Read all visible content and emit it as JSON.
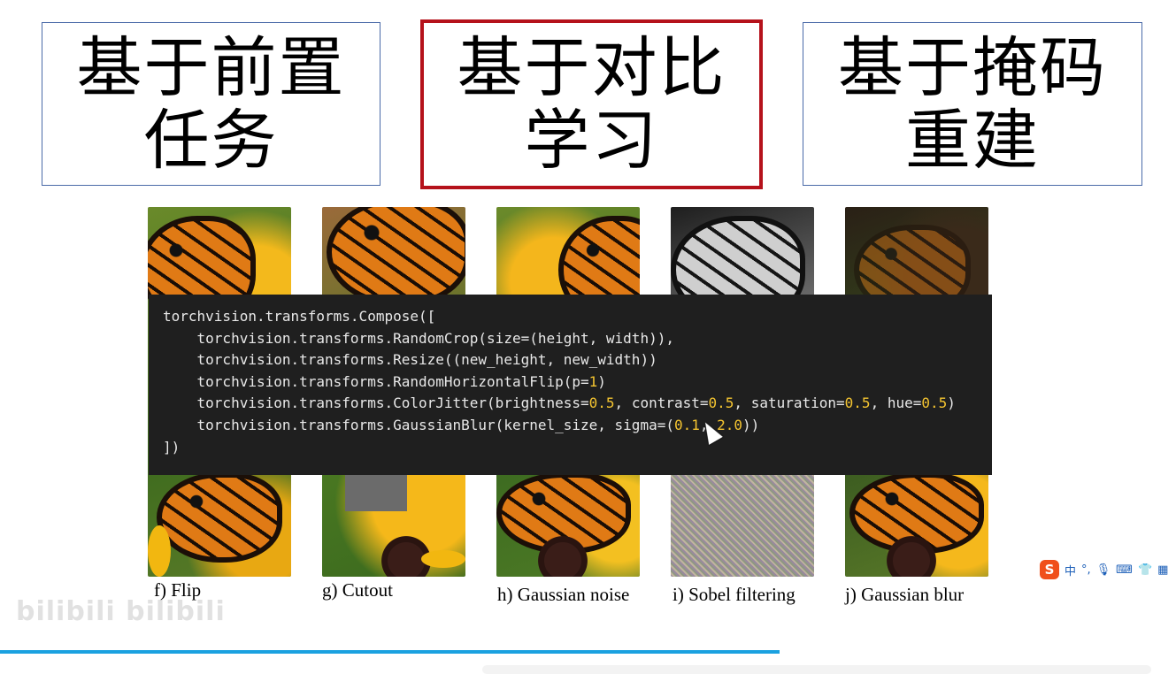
{
  "header": {
    "boxes": [
      {
        "title": "基于前置\n任务"
      },
      {
        "title": "基于对比\n学习"
      },
      {
        "title": "基于掩码\n重建"
      }
    ]
  },
  "images": {
    "captions": [
      "f) Flip",
      "g) Cutout",
      "h) Gaussian noise",
      "i) Sobel filtering",
      "j) Gaussian blur"
    ]
  },
  "code": {
    "lines": [
      "torchvision.transforms.Compose([",
      "    torchvision.transforms.RandomCrop(size=(height, width)),",
      "    torchvision.transforms.Resize((new_height, new_width))",
      "    torchvision.transforms.RandomHorizontalFlip(p=1)",
      "    torchvision.transforms.ColorJitter(brightness=0.5, contrast=0.5, saturation=0.5, hue=0.5)",
      "    torchvision.transforms.GaussianBlur(kernel_size, sigma=(0.1, 2.0))",
      "])"
    ],
    "colors": {
      "background": "#1f1f1f",
      "text": "#e8e8e8",
      "number": "#f4c430"
    }
  },
  "watermark": {
    "text": "bilibili bilibili"
  },
  "ime_toolbar": {
    "logo": "S",
    "label": "中",
    "icons": [
      "punctuation-icon",
      "microphone-icon",
      "keyboard-icon",
      "shirt-icon",
      "grid-icon"
    ]
  },
  "progress": {
    "value": 0.663,
    "color": "#1aa1e0"
  },
  "colors": {
    "active_border": "#b5121b",
    "box_border": "#4a6aa8"
  }
}
